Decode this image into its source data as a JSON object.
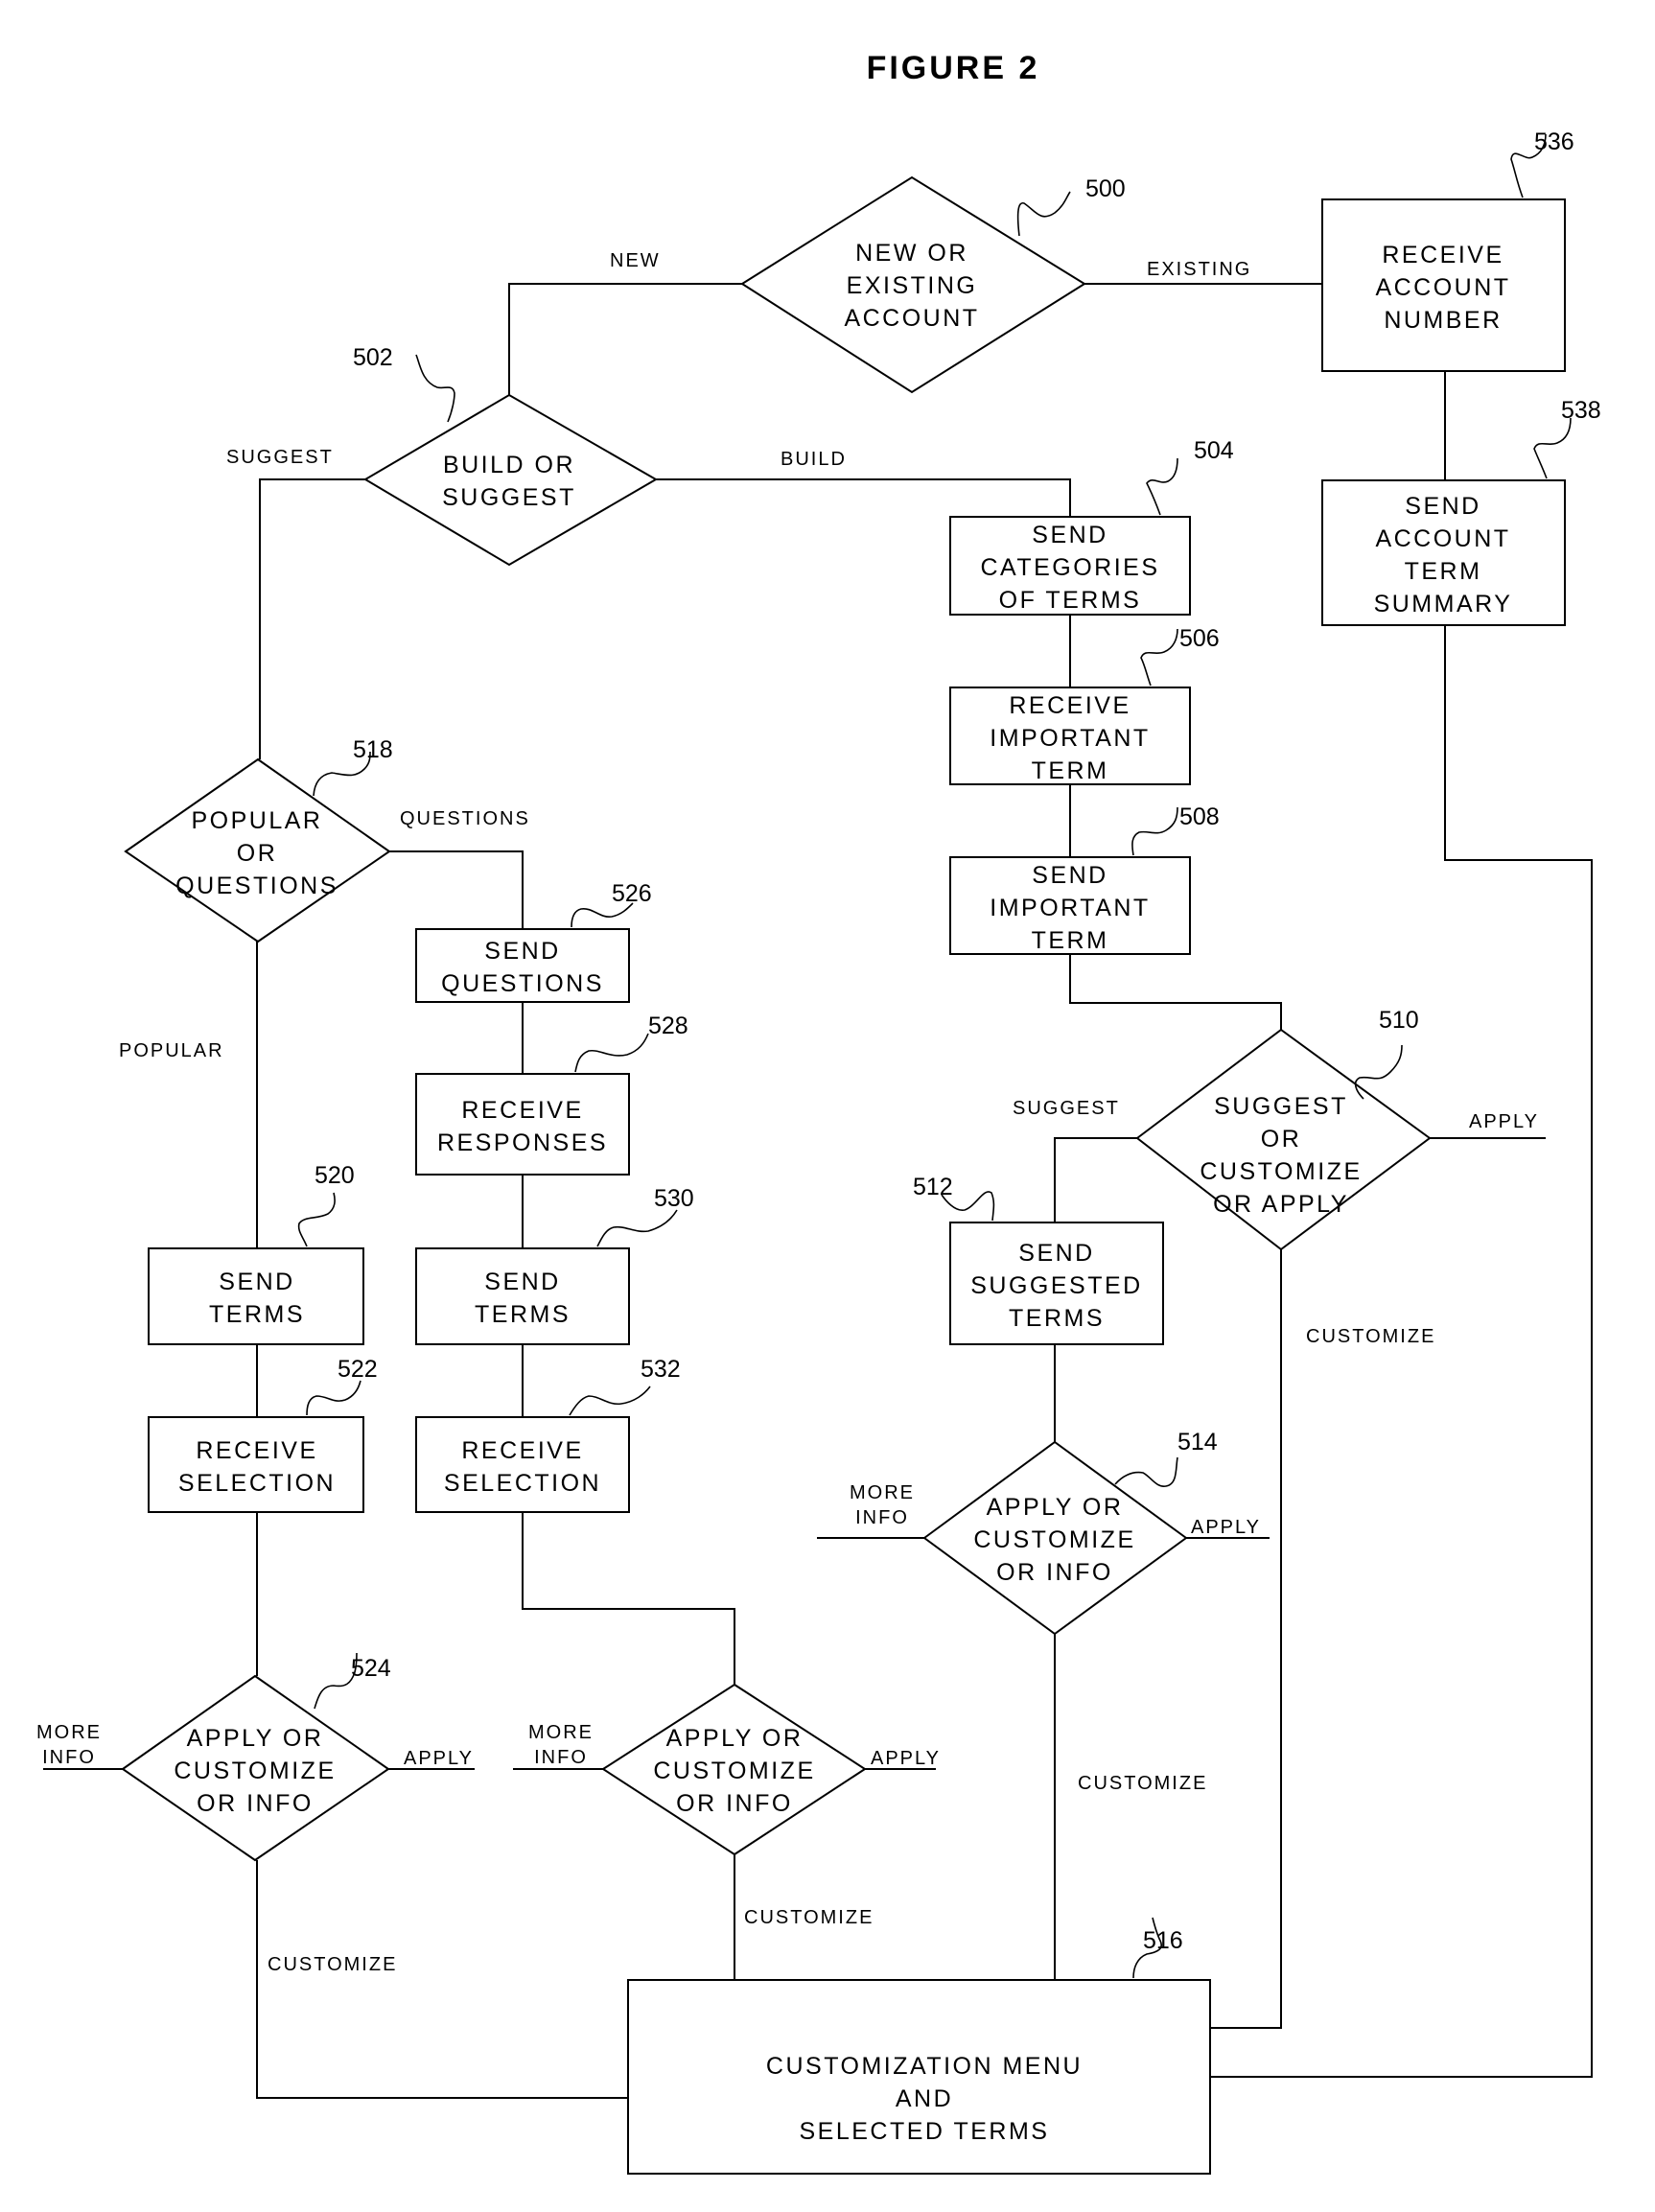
{
  "title": "FIGURE 2",
  "nodes": {
    "n500": {
      "ref": "500",
      "type": "decision",
      "lines": [
        "NEW OR",
        "EXISTING",
        "ACCOUNT"
      ]
    },
    "n502": {
      "ref": "502",
      "type": "decision",
      "lines": [
        "BUILD OR",
        "SUGGEST"
      ]
    },
    "n504": {
      "ref": "504",
      "type": "process",
      "lines": [
        "SEND",
        "CATEGORIES",
        "OF TERMS"
      ]
    },
    "n506": {
      "ref": "506",
      "type": "process",
      "lines": [
        "RECEIVE",
        "IMPORTANT",
        "TERM"
      ]
    },
    "n508": {
      "ref": "508",
      "type": "process",
      "lines": [
        "SEND",
        "IMPORTANT",
        "TERM"
      ]
    },
    "n510": {
      "ref": "510",
      "type": "decision",
      "lines": [
        "SUGGEST",
        "OR",
        "CUSTOMIZE",
        "OR APPLY"
      ]
    },
    "n512": {
      "ref": "512",
      "type": "process",
      "lines": [
        "SEND",
        "SUGGESTED",
        "TERMS"
      ]
    },
    "n514": {
      "ref": "514",
      "type": "decision",
      "lines": [
        "APPLY OR",
        "CUSTOMIZE",
        "OR INFO"
      ]
    },
    "n516": {
      "ref": "516",
      "type": "process",
      "lines": [
        "CUSTOMIZATION MENU",
        "AND",
        "SELECTED TERMS"
      ]
    },
    "n518": {
      "ref": "518",
      "type": "decision",
      "lines": [
        "POPULAR",
        "OR",
        "QUESTIONS"
      ]
    },
    "n520": {
      "ref": "520",
      "type": "process",
      "lines": [
        "SEND",
        "TERMS"
      ]
    },
    "n522": {
      "ref": "522",
      "type": "process",
      "lines": [
        "RECEIVE",
        "SELECTION"
      ]
    },
    "n524": {
      "ref": "524",
      "type": "decision",
      "lines": [
        "APPLY OR",
        "CUSTOMIZE",
        "OR INFO"
      ]
    },
    "n526": {
      "ref": "526",
      "type": "process",
      "lines": [
        "SEND",
        "QUESTIONS"
      ]
    },
    "n528": {
      "ref": "528",
      "type": "process",
      "lines": [
        "RECEIVE",
        "RESPONSES"
      ]
    },
    "n530": {
      "ref": "530",
      "type": "process",
      "lines": [
        "SEND",
        "TERMS"
      ]
    },
    "n532": {
      "ref": "532",
      "type": "process",
      "lines": [
        "RECEIVE",
        "SELECTION"
      ]
    },
    "n534": {
      "ref": "",
      "type": "decision",
      "lines": [
        "APPLY OR",
        "CUSTOMIZE",
        "OR INFO"
      ]
    },
    "n536": {
      "ref": "536",
      "type": "process",
      "lines": [
        "RECEIVE",
        "ACCOUNT",
        "NUMBER"
      ]
    },
    "n538": {
      "ref": "538",
      "type": "process",
      "lines": [
        "SEND",
        "ACCOUNT",
        "TERM",
        "SUMMARY"
      ]
    }
  },
  "edge_labels": {
    "new": "NEW",
    "existing": "EXISTING",
    "suggest_502": "SUGGEST",
    "build": "BUILD",
    "questions": "QUESTIONS",
    "popular": "POPULAR",
    "suggest_510": "SUGGEST",
    "apply_510": "APPLY",
    "customize_510": "CUSTOMIZE",
    "more_info_514": [
      "MORE",
      "INFO"
    ],
    "apply_514": "APPLY",
    "customize_514": "CUSTOMIZE",
    "more_info_524": [
      "MORE",
      "INFO"
    ],
    "apply_524": "APPLY",
    "customize_524": "CUSTOMIZE",
    "more_info_534": [
      "MORE",
      "INFO"
    ],
    "apply_534": "APPLY",
    "customize_534": "CUSTOMIZE"
  }
}
